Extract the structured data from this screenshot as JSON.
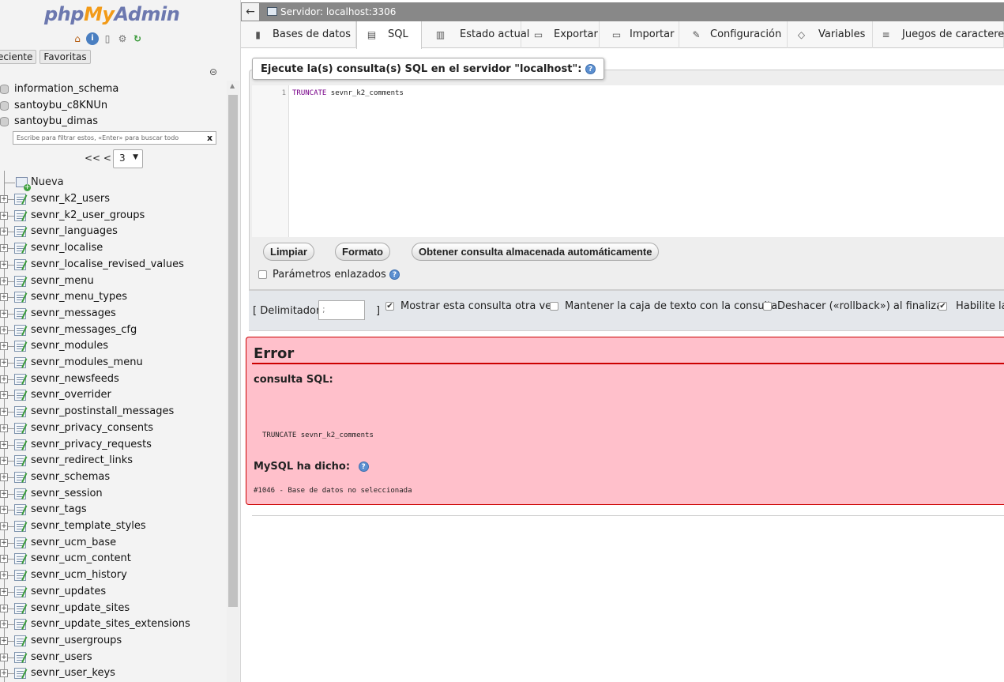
{
  "nav": {
    "logo": {
      "php": "php",
      "my": "My",
      "admin": "Admin"
    },
    "tabs": [
      "eciente",
      "Favoritas"
    ],
    "databases": [
      "information_schema",
      "santoybu_c8KNUn",
      "santoybu_dimas"
    ],
    "filter_placeholder": "Escribe para filtrar estos, «Enter» para buscar todo",
    "filter_clear": "x",
    "pager_prev": "<< <",
    "pager_page": "3",
    "new_label": "Nueva",
    "tables": [
      "sevnr_k2_users",
      "sevnr_k2_user_groups",
      "sevnr_languages",
      "sevnr_localise",
      "sevnr_localise_revised_values",
      "sevnr_menu",
      "sevnr_menu_types",
      "sevnr_messages",
      "sevnr_messages_cfg",
      "sevnr_modules",
      "sevnr_modules_menu",
      "sevnr_newsfeeds",
      "sevnr_overrider",
      "sevnr_postinstall_messages",
      "sevnr_privacy_consents",
      "sevnr_privacy_requests",
      "sevnr_redirect_links",
      "sevnr_schemas",
      "sevnr_session",
      "sevnr_tags",
      "sevnr_template_styles",
      "sevnr_ucm_base",
      "sevnr_ucm_content",
      "sevnr_ucm_history",
      "sevnr_updates",
      "sevnr_update_sites",
      "sevnr_update_sites_extensions",
      "sevnr_usergroups",
      "sevnr_users",
      "sevnr_user_keys"
    ]
  },
  "topbar": {
    "back": "←",
    "server": "Servidor: localhost:3306"
  },
  "menu": [
    {
      "label": "Bases de datos",
      "icon": "database-icon",
      "glyph": "▮"
    },
    {
      "label": "SQL",
      "icon": "sql-icon",
      "glyph": "▤"
    },
    {
      "label": "Estado actual",
      "icon": "status-icon",
      "glyph": "▥"
    },
    {
      "label": "Exportar",
      "icon": "export-icon",
      "glyph": "▭"
    },
    {
      "label": "Importar",
      "icon": "import-icon",
      "glyph": "▭"
    },
    {
      "label": "Configuración",
      "icon": "wrench-icon",
      "glyph": "✎"
    },
    {
      "label": "Variables",
      "icon": "variables-icon",
      "glyph": "◇"
    },
    {
      "label": "Juegos de caracteres",
      "icon": "charset-icon",
      "glyph": "≡"
    }
  ],
  "sql": {
    "legend": "Ejecute la(s) consulta(s) SQL en el servidor \"localhost\":",
    "line_no": "1",
    "code_kw": "TRUNCATE",
    "code_rest": " sevnr_k2_comments",
    "btn_clear": "Limpiar",
    "btn_format": "Formato",
    "btn_stored": "Obtener consulta almacenada automáticamente",
    "params_label": "Parámetros enlazados"
  },
  "options": {
    "delim_open": "[ Delimitador",
    "delim_value": ";",
    "delim_close": "]",
    "show_query": "Mostrar esta consulta otra vez",
    "keep_box": "Mantener la caja de texto con la consulta",
    "rollback": "Deshacer («rollback») al finalizar",
    "enable": "Habilite la",
    "check": "✔"
  },
  "error": {
    "title": "Error",
    "query_label": "consulta SQL:",
    "query": "TRUNCATE sevnr_k2_comments",
    "mysql_label": "MySQL ha dicho:",
    "message": "#1046 - Base de datos no seleccionada"
  }
}
